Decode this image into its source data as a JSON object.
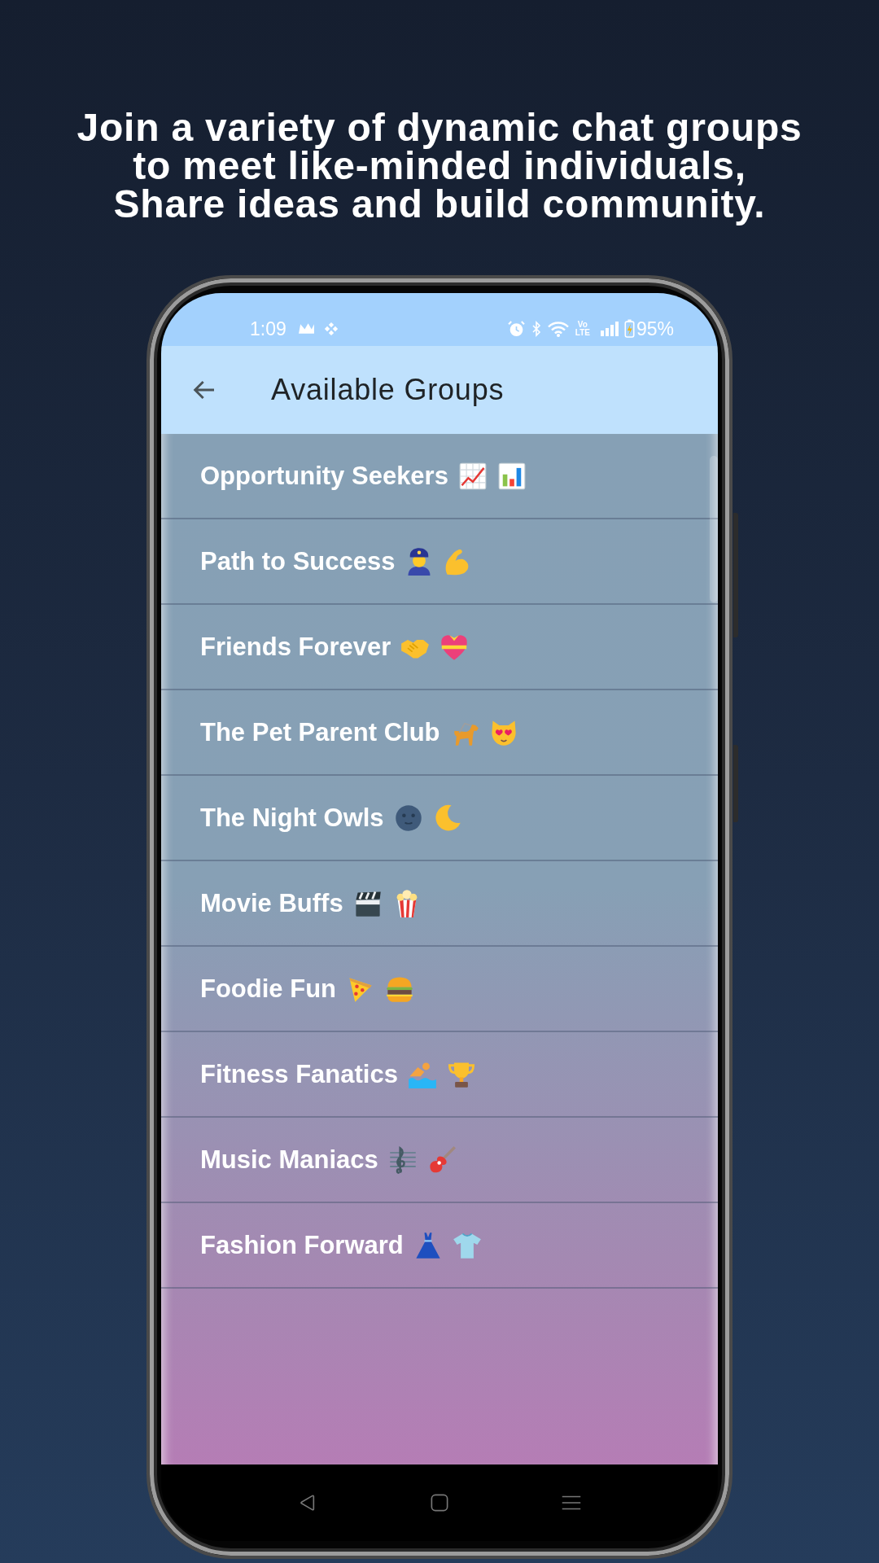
{
  "headline": [
    "Join a variety of dynamic chat groups",
    "to meet like-minded individuals,",
    "Share ideas and build community."
  ],
  "phone": {
    "status_bar": {
      "time": "1:09",
      "network_label": [
        "Vo",
        "LTE"
      ],
      "battery": "95%"
    },
    "app_bar": {
      "title": "Available Groups"
    },
    "groups": [
      {
        "name": "Opportunity Seekers",
        "emojis": [
          {
            "kind": "trend"
          },
          {
            "kind": "bars"
          }
        ]
      },
      {
        "name": "Path to Success",
        "emojis": [
          {
            "kind": "officer"
          },
          {
            "kind": "biceps"
          }
        ]
      },
      {
        "name": "Friends Forever",
        "emojis": [
          {
            "kind": "handshake"
          },
          {
            "kind": "giftheart"
          }
        ]
      },
      {
        "name": "The Pet Parent Club",
        "emojis": [
          {
            "kind": "guidedog"
          },
          {
            "kind": "heartcat"
          }
        ]
      },
      {
        "name": "The Night Owls",
        "emojis": [
          {
            "kind": "moonface"
          },
          {
            "kind": "crescent"
          }
        ]
      },
      {
        "name": "Movie Buffs",
        "emojis": [
          {
            "kind": "clapper"
          },
          {
            "kind": "popcorn"
          }
        ]
      },
      {
        "name": "Foodie Fun",
        "emojis": [
          {
            "kind": "pizza"
          },
          {
            "kind": "burger"
          }
        ]
      },
      {
        "name": "Fitness Fanatics",
        "emojis": [
          {
            "kind": "swimmer"
          },
          {
            "kind": "trophy"
          }
        ]
      },
      {
        "name": "Music Maniacs",
        "emojis": [
          {
            "kind": "score"
          },
          {
            "kind": "guitar"
          }
        ]
      },
      {
        "name": "Fashion Forward",
        "emojis": [
          {
            "kind": "dress"
          },
          {
            "kind": "tshirt"
          }
        ]
      }
    ]
  }
}
